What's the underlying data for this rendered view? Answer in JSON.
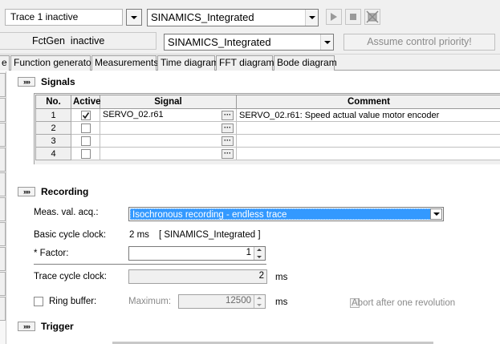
{
  "toolbar": {
    "trace_status": "Trace 1 inactive",
    "trace_device": "SINAMICS_Integrated",
    "fctgen_status": "FctGen  inactive",
    "fctgen_device": "SINAMICS_Integrated",
    "assume_label": "Assume control priority!",
    "play_icon": "play-icon",
    "stop_icon": "stop-icon",
    "disconnect_icon": "disconnect-icon"
  },
  "tabs": [
    {
      "label": "e"
    },
    {
      "label": "Function generator"
    },
    {
      "label": "Measurements"
    },
    {
      "label": "Time diagram"
    },
    {
      "label": "FFT diagram"
    },
    {
      "label": "Bode diagram"
    }
  ],
  "signals": {
    "expand_label": "»»",
    "title": "Signals",
    "columns": {
      "no": "No.",
      "active": "Active",
      "signal": "Signal",
      "comment": "Comment"
    },
    "rows": [
      {
        "no": "1",
        "active": true,
        "signal": "SERVO_02.r61",
        "comment": "SERVO_02.r61: Speed actual value motor encoder"
      },
      {
        "no": "2",
        "active": false,
        "signal": "",
        "comment": ""
      },
      {
        "no": "3",
        "active": false,
        "signal": "",
        "comment": ""
      },
      {
        "no": "4",
        "active": false,
        "signal": "",
        "comment": ""
      }
    ],
    "ellipsis": "···"
  },
  "recording": {
    "expand_label": "»»",
    "title": "Recording",
    "meas_label": "Meas. val. acq.:",
    "meas_value": "Isochronous recording - endless trace",
    "basic_cycle_label": "Basic cycle clock:",
    "basic_cycle_value": "2 ms",
    "basic_cycle_device": "[ SINAMICS_Integrated ]",
    "factor_label": "* Factor:",
    "factor_value": "1",
    "trace_cycle_label": "Trace cycle clock:",
    "trace_cycle_value": "2",
    "trace_cycle_unit": "ms",
    "ring_buffer_label": "Ring buffer:",
    "maximum_label": "Maximum:",
    "maximum_value": "12500",
    "maximum_unit": "ms",
    "abort_label": "Abort after one revolution"
  },
  "trigger": {
    "expand_label": "»»",
    "title": "Trigger"
  }
}
